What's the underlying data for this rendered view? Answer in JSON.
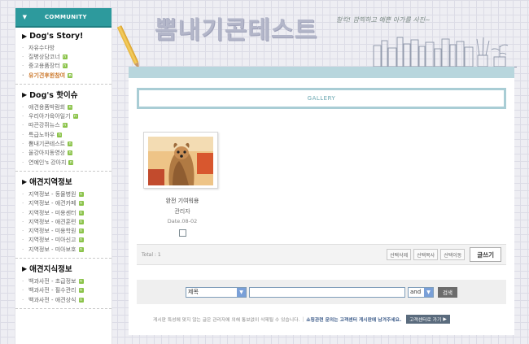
{
  "sidebar": {
    "header": "COMMUNITY",
    "sections": [
      {
        "title": "Dog's Story!",
        "items": [
          {
            "label": "자유수다방",
            "new": false,
            "highlight": false
          },
          {
            "label": "질병상담코너",
            "new": true,
            "highlight": false
          },
          {
            "label": "중고용품장터",
            "new": true,
            "highlight": false
          },
          {
            "label": "유기견후원참여",
            "new": true,
            "highlight": true
          }
        ]
      },
      {
        "title": "Dog's 핫이슈",
        "items": [
          {
            "label": "애견용품박람회",
            "new": true,
            "highlight": false
          },
          {
            "label": "우리아가육아일기",
            "new": true,
            "highlight": false
          },
          {
            "label": "따끈강쥐뉴스",
            "new": true,
            "highlight": false
          },
          {
            "label": "특급노하우",
            "new": true,
            "highlight": false
          },
          {
            "label": "뽐내기콘테스트",
            "new": true,
            "highlight": false
          },
          {
            "label": "울강아지동영상",
            "new": true,
            "highlight": false
          },
          {
            "label": "연예인's 강아지",
            "new": true,
            "highlight": false
          }
        ]
      },
      {
        "title": "애견지역정보",
        "items": [
          {
            "label": "지역정보 - 동물병원",
            "new": true,
            "highlight": false
          },
          {
            "label": "지역정보 - 애견카페",
            "new": true,
            "highlight": false
          },
          {
            "label": "지역정보 - 미용센터",
            "new": true,
            "highlight": false
          },
          {
            "label": "지역정보 - 애견훈련",
            "new": true,
            "highlight": false
          },
          {
            "label": "지역정보 - 미용학원",
            "new": true,
            "highlight": false
          },
          {
            "label": "지역정보 - 미아신고",
            "new": true,
            "highlight": false
          },
          {
            "label": "지역정보 - 미아보호",
            "new": true,
            "highlight": false
          }
        ]
      },
      {
        "title": "애견지식정보",
        "items": [
          {
            "label": "백과사전 - 초급정보",
            "new": true,
            "highlight": false
          },
          {
            "label": "백과사전 - 필수관리",
            "new": true,
            "highlight": false
          },
          {
            "label": "백과사전 - 애견상식",
            "new": true,
            "highlight": false
          }
        ]
      }
    ]
  },
  "header": {
    "logo_text": "뽐내기콘테스트",
    "slogan": "찰칵! 깜찍하고 예쁜 아가를 사진~"
  },
  "board": {
    "title": "GALLERY",
    "item": {
      "title": "완전 기여워용",
      "author": "관리자",
      "date": "Date.08-02"
    },
    "total": "Total : 1",
    "buttons": {
      "delete": "선택삭제",
      "copy": "선택복사",
      "move": "선택이동",
      "write": "글쓰기"
    }
  },
  "search": {
    "field_option": "제목",
    "keyword": "",
    "operator": "and",
    "submit": "검색"
  },
  "notice": {
    "text1": "게시판 특성에 맞지 않는 글은 관리자에 의해 통보없이 삭제될 수 있습니다.",
    "separator": "|",
    "text2": "쇼핑관련 문의는 고객센터 게시판에 남겨주세요.",
    "cs_button": "고객센터로 가기"
  },
  "colors": {
    "accent_teal": "#2d9a9d",
    "panel_strip": "#b8d6dd",
    "highlight_orange": "#cc7a2e",
    "new_badge": "#8bc34a"
  }
}
